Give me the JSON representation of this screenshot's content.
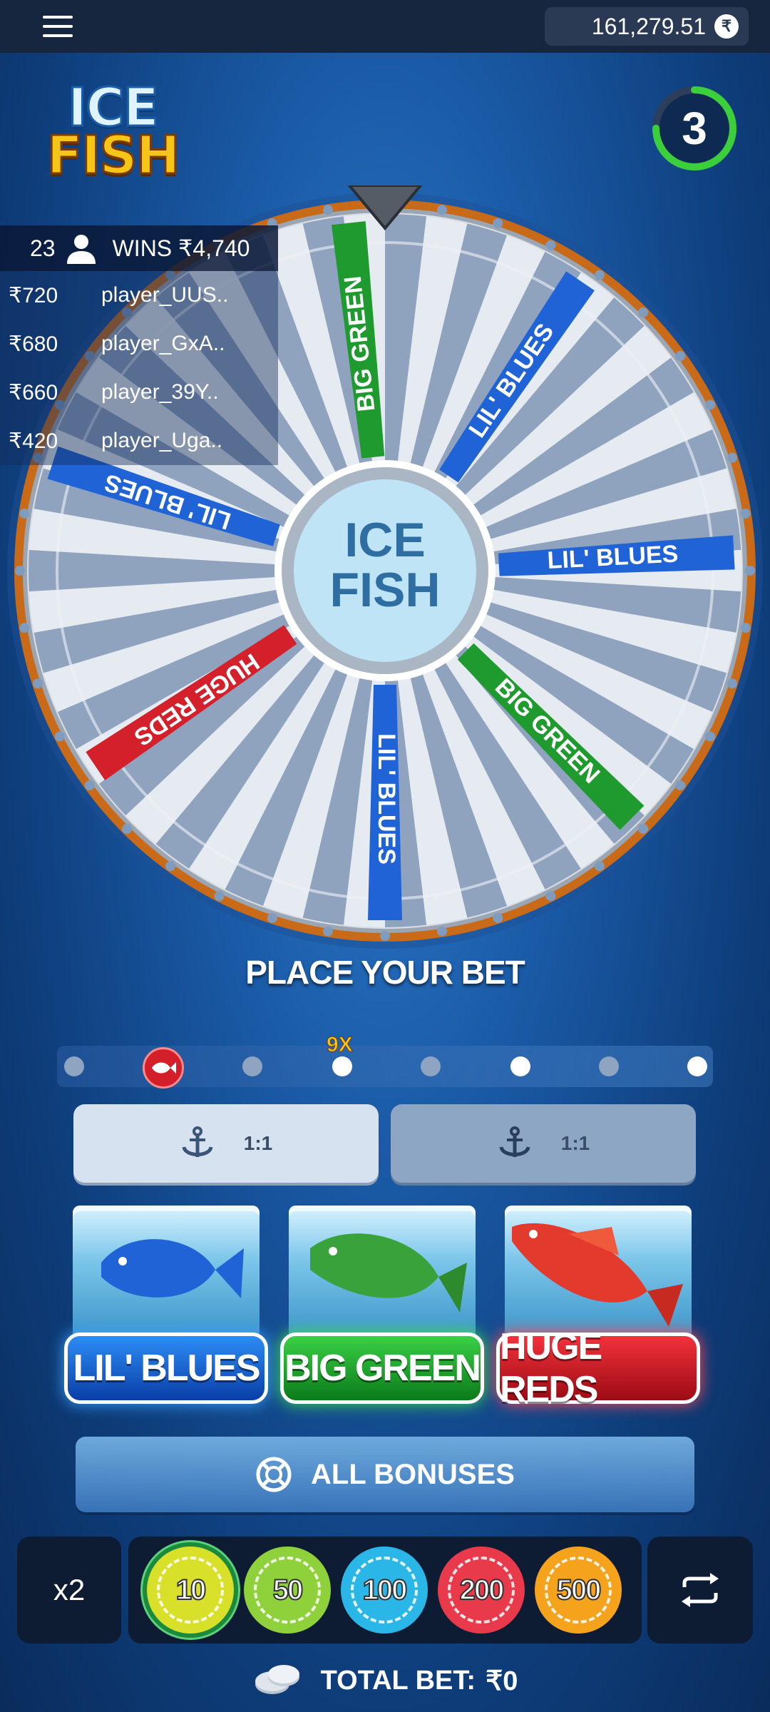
{
  "topbar": {
    "balance": "161,279.51",
    "currency_symbol": "₹"
  },
  "logo": {
    "line1": "ICE",
    "line2": "FISH"
  },
  "timer": {
    "seconds": "3",
    "progress": 0.75
  },
  "wheel": {
    "center_line1": "ICE",
    "center_line2": "FISH",
    "labels": [
      "BIG GREEN",
      "LIL' BLUES",
      "LIL' BLUES",
      "BIG GREEN",
      "LIL' BLUES",
      "HUGE REDS",
      "LIL' BLUES"
    ]
  },
  "players": {
    "count": "23",
    "wins": "WINS ₹4,740",
    "rows": [
      {
        "amount": "₹720",
        "name": "player_UUS.."
      },
      {
        "amount": "₹680",
        "name": "player_GxA.."
      },
      {
        "amount": "₹660",
        "name": "player_39Y.."
      },
      {
        "amount": "₹420",
        "name": "player_Uga.."
      }
    ]
  },
  "status": "PLACE YOUR BET",
  "history": {
    "multiplier": "9X"
  },
  "bets": {
    "left_odds": "1:1",
    "right_odds": "1:1"
  },
  "fish": [
    {
      "label": "LIL' BLUES",
      "color": "#1f63d6"
    },
    {
      "label": "BIG GREEN",
      "color": "#1f9a2e"
    },
    {
      "label": "HUGE REDS",
      "color": "#d4202b"
    }
  ],
  "bonuses": {
    "label": "ALL BONUSES"
  },
  "controls": {
    "x2": "x2"
  },
  "chips": [
    {
      "value": "10",
      "color": "#d8e02a"
    },
    {
      "value": "50",
      "color": "#8fd13a"
    },
    {
      "value": "100",
      "color": "#2bb6e8"
    },
    {
      "value": "200",
      "color": "#e83a4a"
    },
    {
      "value": "500",
      "color": "#f5a21c"
    }
  ],
  "total_bet": {
    "label": "TOTAL BET:",
    "value": "₹0"
  }
}
